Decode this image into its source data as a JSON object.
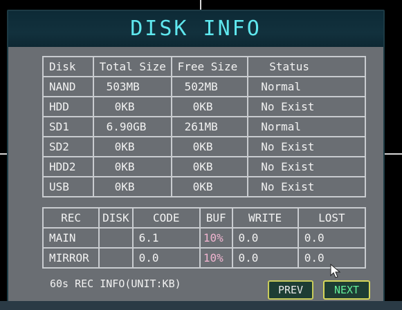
{
  "title": "DISK INFO",
  "disk_table": {
    "headers": [
      "Disk",
      "Total Size",
      "Free Size",
      "Status"
    ],
    "rows": [
      [
        "NAND",
        "503MB",
        "502MB",
        "Normal"
      ],
      [
        "HDD",
        "0KB",
        "0KB",
        "No Exist"
      ],
      [
        "SD1",
        "6.90GB",
        "261MB",
        "Normal"
      ],
      [
        "SD2",
        "0KB",
        "0KB",
        "No Exist"
      ],
      [
        "HDD2",
        "0KB",
        "0KB",
        "No Exist"
      ],
      [
        "USB",
        "0KB",
        "0KB",
        "No Exist"
      ]
    ]
  },
  "rec_table": {
    "headers": [
      "REC",
      "DISK",
      "CODE",
      "BUF",
      "WRITE",
      "LOST"
    ],
    "rows": [
      [
        "MAIN",
        "",
        "6.1",
        "10%",
        "0.0",
        "0.0"
      ],
      [
        "MIRROR",
        "",
        "0.0",
        "10%",
        "0.0",
        "0.0"
      ]
    ]
  },
  "footnote": "60s REC INFO(UNIT:KB)",
  "buttons": {
    "prev": "PREV",
    "next": "NEXT"
  },
  "colors": {
    "title": "#5fe7ee",
    "panel": "#6a6e73",
    "next_text": "#64f09a",
    "buf_text": "#f0b4d0"
  },
  "icons": {
    "cursor": "mouse-pointer-icon"
  }
}
